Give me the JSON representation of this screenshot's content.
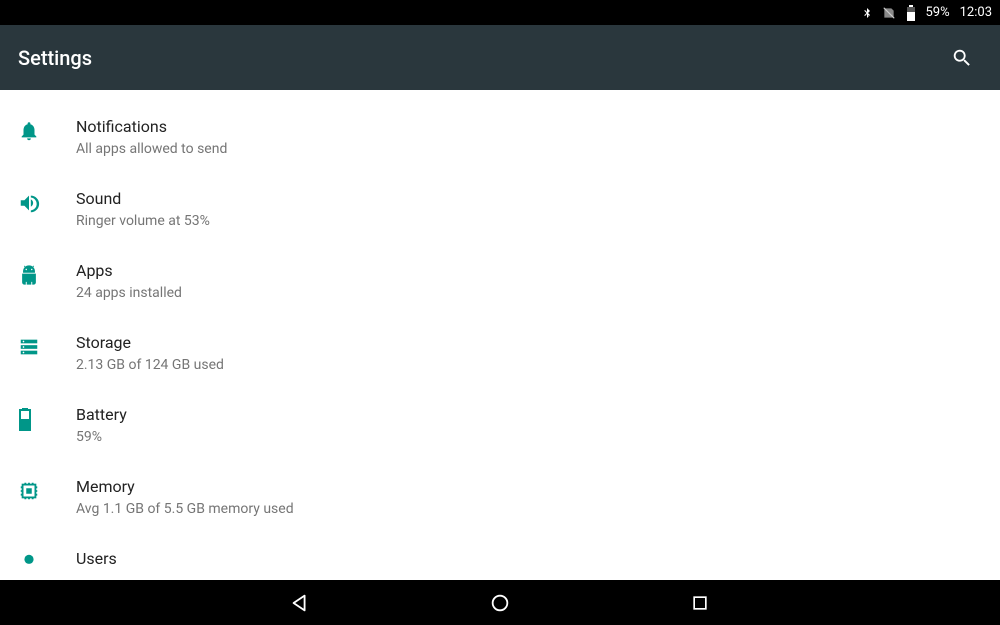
{
  "status": {
    "battery_text": "59%",
    "time": "12:03"
  },
  "appbar": {
    "title": "Settings"
  },
  "items": [
    {
      "title": "Notifications",
      "subtitle": "All apps allowed to send"
    },
    {
      "title": "Sound",
      "subtitle": "Ringer volume at 53%"
    },
    {
      "title": "Apps",
      "subtitle": "24 apps installed"
    },
    {
      "title": "Storage",
      "subtitle": "2.13 GB of 124 GB used"
    },
    {
      "title": "Battery",
      "subtitle": "59%"
    },
    {
      "title": "Memory",
      "subtitle": "Avg 1.1 GB of 5.5 GB memory used"
    },
    {
      "title": "Users",
      "subtitle": ""
    }
  ]
}
